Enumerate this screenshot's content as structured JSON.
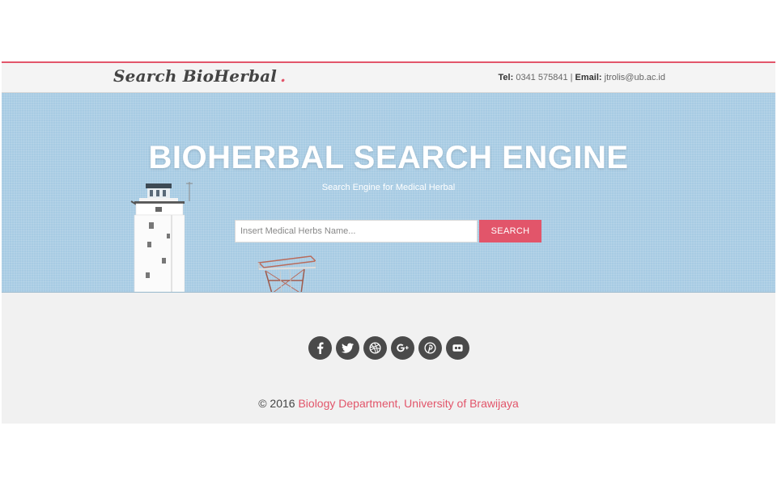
{
  "navbar": {
    "brand": "Search BioHerbal",
    "brand_dot": ".",
    "tel_label": "Tel:",
    "tel_value": "0341 575841",
    "separator": "|",
    "email_label": "Email:",
    "email_value": "jtrolis@ub.ac.id"
  },
  "hero": {
    "title": "BIOHERBAL SEARCH ENGINE",
    "subtitle": "Search Engine for Medical Herbal",
    "search_placeholder": "Insert Medical Herbs Name...",
    "search_value": "",
    "search_button": "SEARCH"
  },
  "social": {
    "icons": [
      "facebook-icon",
      "twitter-icon",
      "dribbble-icon",
      "google-plus-icon",
      "pinterest-icon",
      "flickr-icon"
    ]
  },
  "footer": {
    "copyright": "© 2016",
    "link": "Biology Department, University of Brawijaya"
  },
  "colors": {
    "accent": "#e2556a",
    "hero_bg": "#a7cbe3",
    "page_bg": "#f1f1f1",
    "icon_bg": "#4a4a4a"
  }
}
